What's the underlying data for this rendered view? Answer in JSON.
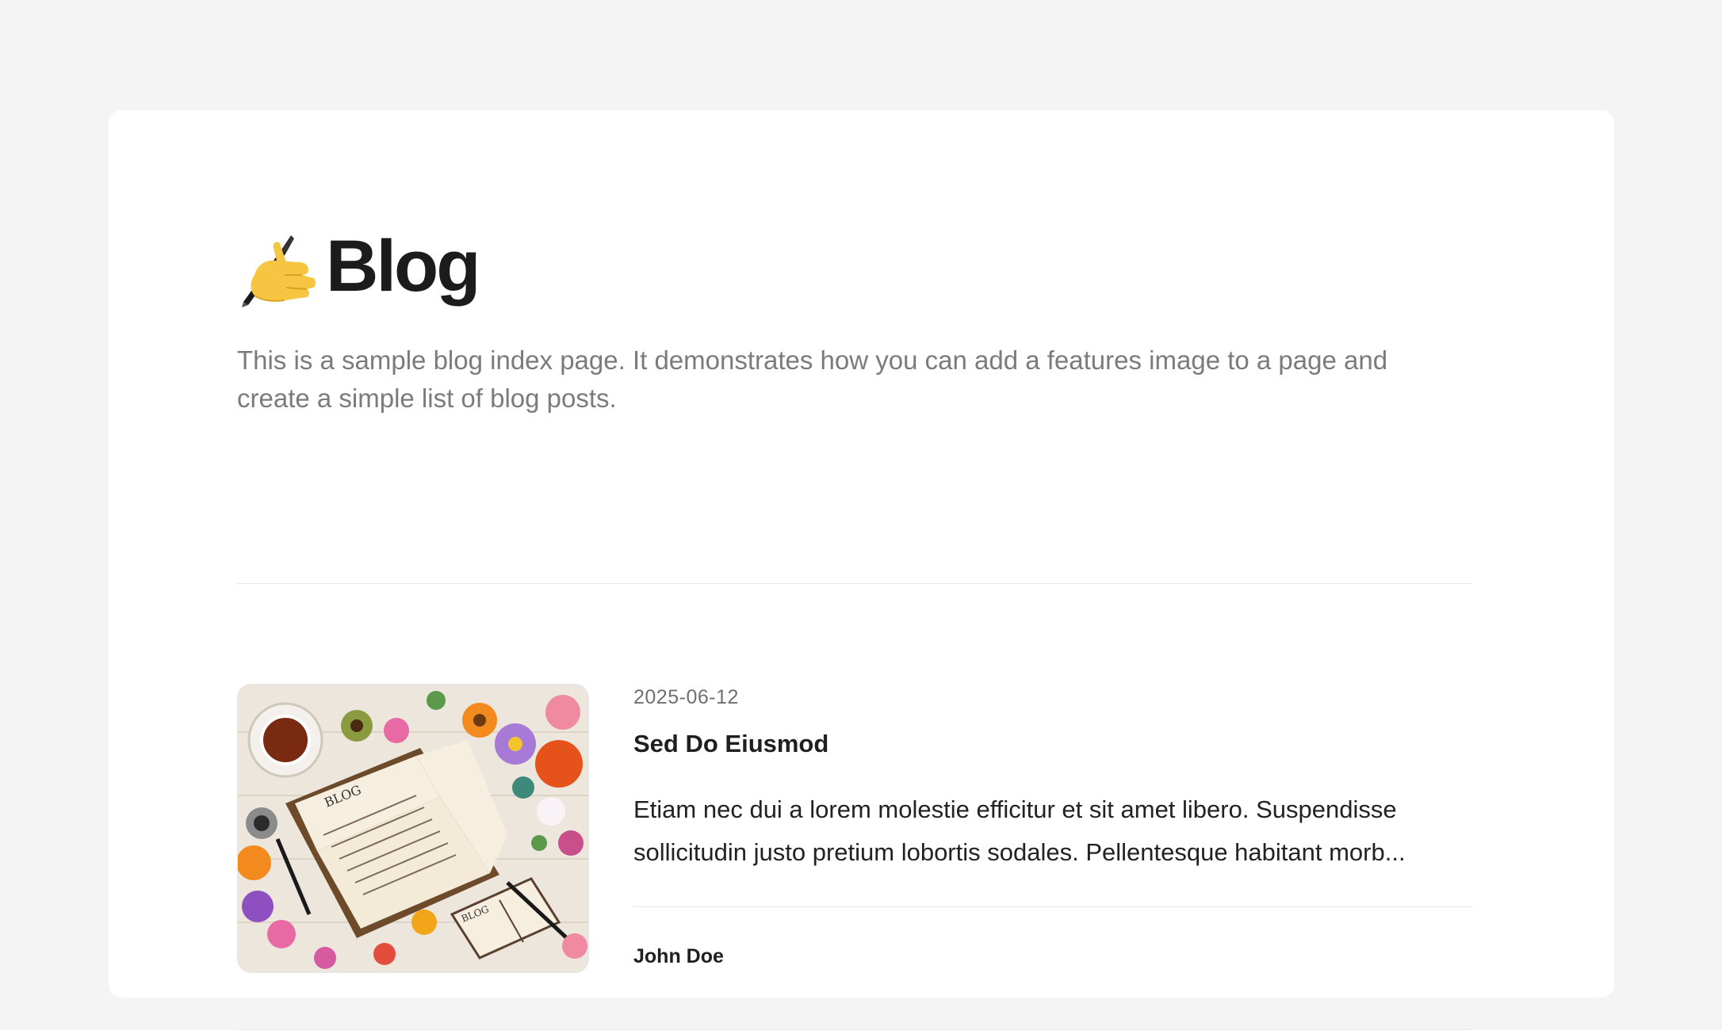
{
  "page": {
    "title_icon": "writing-hand-icon",
    "title": "Blog",
    "description": "This is a sample blog index page. It demonstrates how you can add a features image to a page and create a simple list of blog posts."
  },
  "posts": [
    {
      "thumbnail": "blog-featured-image",
      "date": "2025-06-12",
      "title": "Sed Do Eiusmod",
      "excerpt": "Etiam nec dui a lorem molestie efficitur et sit amet libero. Suspendisse sollicitudin justo pretium lobortis sodales. Pellentesque habitant morb...",
      "author": "John Doe"
    }
  ],
  "colors": {
    "background": "#f4f4f4",
    "card": "#ffffff",
    "title": "#1c1c1c",
    "description": "#7b7b7b",
    "divider": "#e8e8e8",
    "date": "#6f6f6f"
  }
}
